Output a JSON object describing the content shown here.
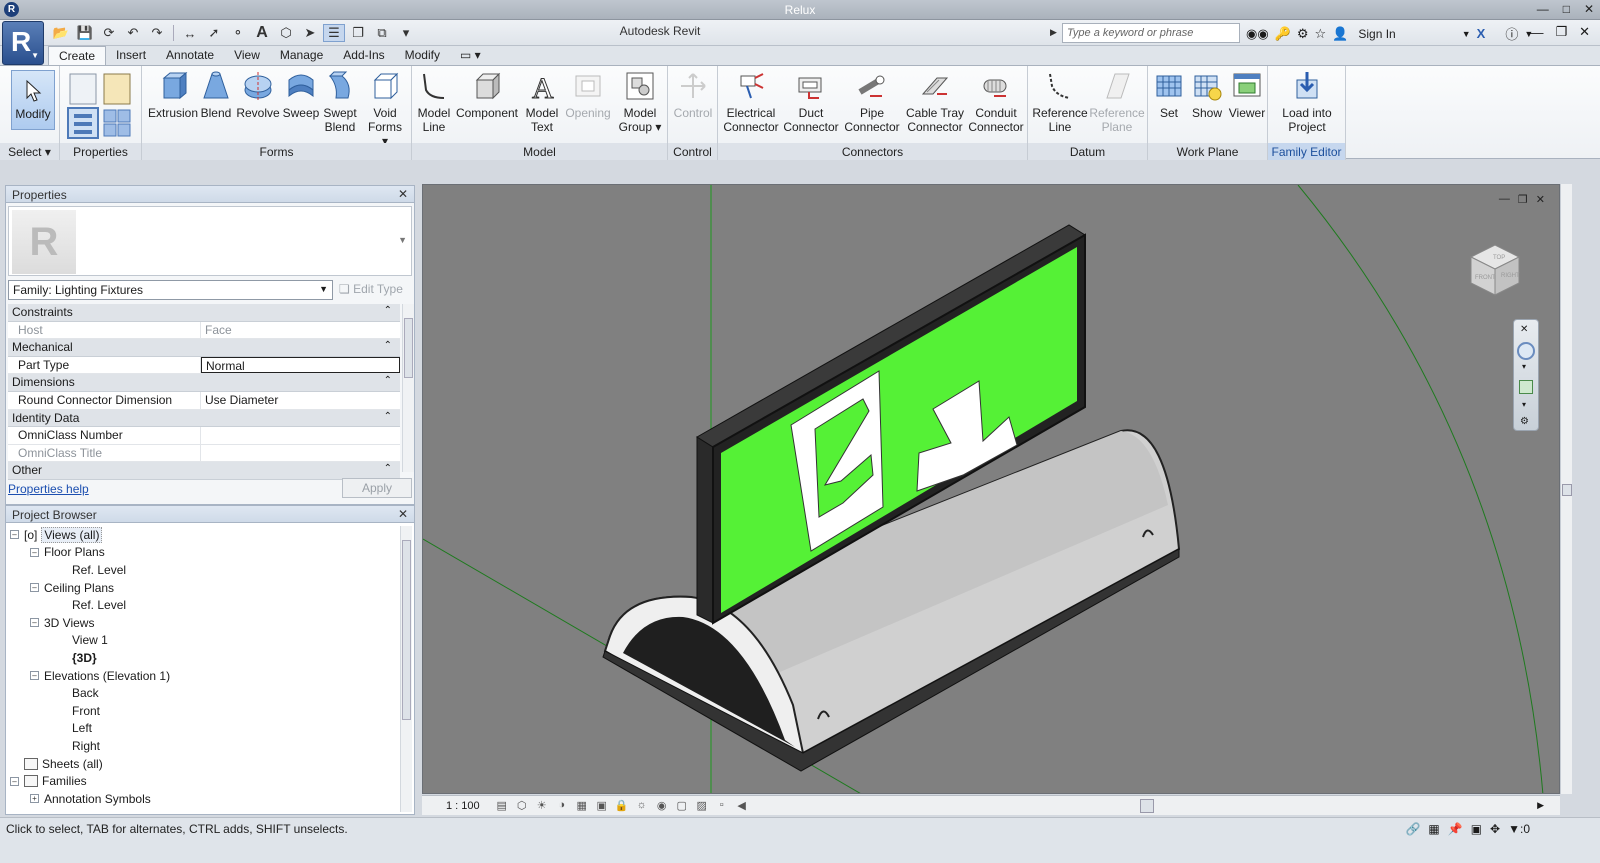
{
  "window": {
    "os_title": "Relux",
    "app_title": "Autodesk Revit"
  },
  "quick_access": {
    "search_placeholder": "Type a keyword or phrase",
    "sign_in": "Sign In"
  },
  "ribbon": {
    "tabs": [
      "Create",
      "Insert",
      "Annotate",
      "View",
      "Manage",
      "Add-Ins",
      "Modify"
    ],
    "active_tab": "Create",
    "panels": {
      "select": {
        "label": "Select",
        "modify": "Modify"
      },
      "properties": {
        "label": "Properties"
      },
      "forms": {
        "label": "Forms",
        "extrusion": "Extrusion",
        "blend": "Blend",
        "revolve": "Revolve",
        "sweep": "Sweep",
        "swept_blend_1": "Swept",
        "swept_blend_2": "Blend",
        "void_1": "Void",
        "void_2": "Forms"
      },
      "model": {
        "label": "Model",
        "line_1": "Model",
        "line_2": "Line",
        "component": "Component",
        "text_1": "Model",
        "text_2": "Text",
        "opening": "Opening",
        "group_1": "Model",
        "group_2": "Group"
      },
      "control": {
        "label": "Control",
        "control": "Control"
      },
      "connectors": {
        "label": "Connectors",
        "elec_1": "Electrical",
        "elec_2": "Connector",
        "duct_1": "Duct",
        "duct_2": "Connector",
        "pipe_1": "Pipe",
        "pipe_2": "Connector",
        "tray_1": "Cable Tray",
        "tray_2": "Connector",
        "conduit_1": "Conduit",
        "conduit_2": "Connector"
      },
      "datum": {
        "label": "Datum",
        "ref_line_1": "Reference",
        "ref_line_2": "Line",
        "ref_plane_1": "Reference",
        "ref_plane_2": "Plane"
      },
      "work_plane": {
        "label": "Work Plane",
        "set": "Set",
        "show": "Show",
        "viewer": "Viewer"
      },
      "family_editor": {
        "label": "Family Editor",
        "load_1": "Load into",
        "load_2": "Project"
      }
    }
  },
  "properties": {
    "title": "Properties",
    "family_type": "Family: Lighting Fixtures",
    "edit_type": "Edit Type",
    "groups": {
      "constraints": "Constraints",
      "mechanical": "Mechanical",
      "dimensions": "Dimensions",
      "identity": "Identity Data",
      "other": "Other"
    },
    "rows": {
      "host_k": "Host",
      "host_v": "Face",
      "part_k": "Part Type",
      "part_v": "Normal",
      "round_k": "Round Connector Dimension",
      "round_v": "Use Diameter",
      "omni_num_k": "OmniClass Number",
      "omni_num_v": "",
      "omni_title_k": "OmniClass Title",
      "omni_title_v": ""
    },
    "help_link": "Properties help",
    "apply": "Apply"
  },
  "browser": {
    "title": "Project Browser",
    "nodes": {
      "views_all": "Views (all)",
      "floor_plans": "Floor Plans",
      "fp_ref": "Ref. Level",
      "ceiling_plans": "Ceiling Plans",
      "cp_ref": "Ref. Level",
      "views_3d": "3D Views",
      "view1": "View 1",
      "view3d": "{3D}",
      "elevations": "Elevations (Elevation 1)",
      "back": "Back",
      "front": "Front",
      "left": "Left",
      "right": "Right",
      "sheets": "Sheets (all)",
      "families": "Families",
      "annotation": "Annotation Symbols"
    }
  },
  "viewport": {
    "scale": "1 : 100",
    "viewcube_top": "TOP",
    "viewcube_front": "FRONT",
    "viewcube_right": "RIGHT"
  },
  "status": {
    "message": "Click to select, TAB for alternates, CTRL adds, SHIFT unselects.",
    "filter_count": ":0"
  },
  "colors": {
    "sign_green": "#55f136",
    "accent_blue": "#2a4f8e",
    "viewport_bg": "#808080"
  }
}
